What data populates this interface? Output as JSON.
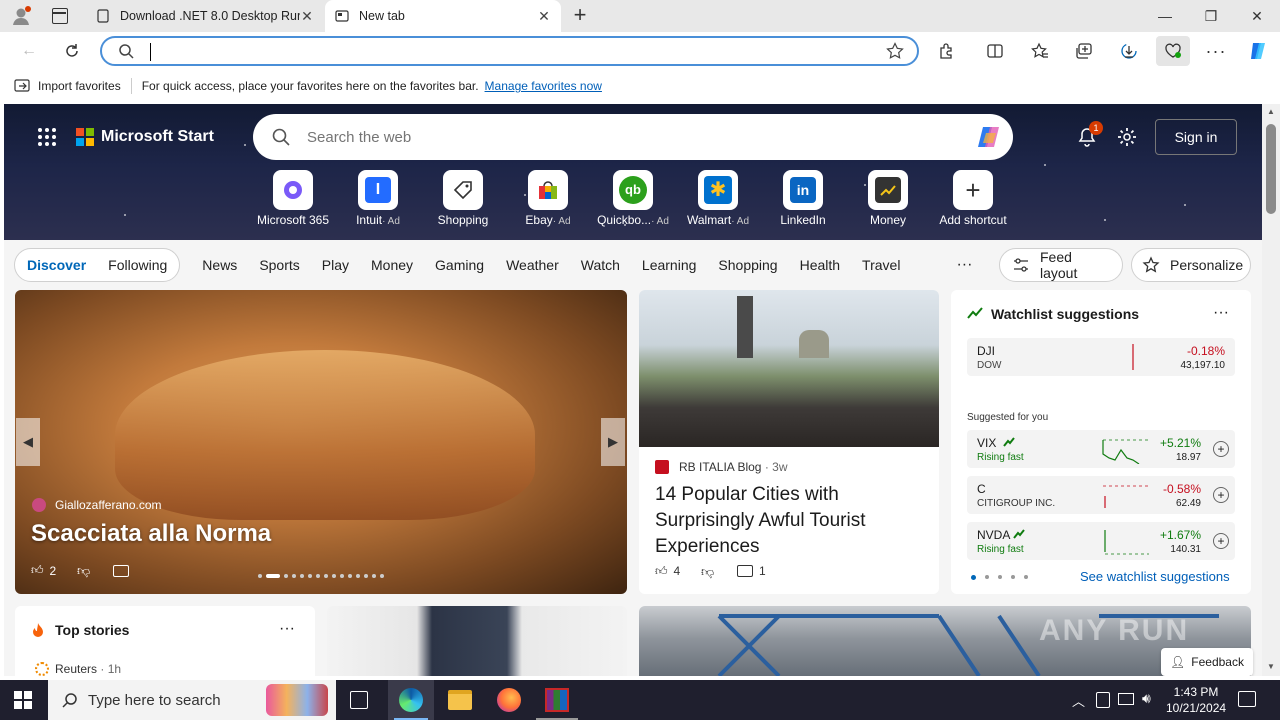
{
  "tabs": [
    {
      "title": "Download .NET 8.0 Desktop Runt",
      "close": "✕"
    },
    {
      "title": "New tab",
      "close": "✕"
    }
  ],
  "new_tab_symbol": "+",
  "window_controls": {
    "minimize": "—",
    "maximize": "❐",
    "close": "✕"
  },
  "address": {
    "value": "",
    "placeholder": ""
  },
  "favorites_bar": {
    "import_label": "Import favorites",
    "message": "For quick access, place your favorites here on the favorites bar.",
    "manage_link": "Manage favorites now"
  },
  "msn": {
    "brand": "Microsoft Start",
    "search_placeholder": "Search the web",
    "notification_count": "1",
    "sign_in": "Sign in",
    "shortcuts": [
      {
        "label": "Microsoft 365",
        "icon": "microsoft-365-icon",
        "ad": ""
      },
      {
        "label": "Intuit",
        "icon": "intuit-icon",
        "ad": "· Ad"
      },
      {
        "label": "Shopping",
        "icon": "shopping-tag-icon",
        "ad": ""
      },
      {
        "label": "Ebay",
        "icon": "ebay-bag-icon",
        "ad": "· Ad"
      },
      {
        "label": "Quickbo...",
        "icon": "quickbooks-icon",
        "ad": "· Ad"
      },
      {
        "label": "Walmart",
        "icon": "walmart-icon",
        "ad": "· Ad"
      },
      {
        "label": "LinkedIn",
        "icon": "linkedin-icon",
        "ad": ""
      },
      {
        "label": "Money",
        "icon": "money-chart-icon",
        "ad": ""
      },
      {
        "label": "Add shortcut",
        "icon": "plus-icon",
        "ad": ""
      }
    ],
    "feed_tabs": {
      "active": "Discover",
      "second": "Following"
    },
    "nav_items": [
      "News",
      "Sports",
      "Play",
      "Money",
      "Gaming",
      "Weather",
      "Watch",
      "Learning",
      "Shopping",
      "Health",
      "Travel"
    ],
    "more": "···",
    "feed_layout": "Feed layout",
    "personalize": "Personalize"
  },
  "hero_article": {
    "source": "Giallozafferano.com",
    "title": "Scacciata alla Norma",
    "likes": "2"
  },
  "article2": {
    "source": "RB ITALIA Blog",
    "age": "· 3w",
    "title": "14 Popular Cities with Surprisingly Awful Tourist Experiences",
    "likes": "4",
    "comments": "1"
  },
  "watchlist": {
    "title": "Watchlist suggestions",
    "more": "···",
    "suggested_label": "Suggested for you",
    "link": "See watchlist suggestions",
    "items": [
      {
        "symbol": "DJI",
        "name": "DOW",
        "change": "-0.18%",
        "price": "43,197.10",
        "direction": "down",
        "rising": false
      },
      {
        "symbol": "VIX",
        "name": "Rising fast",
        "change": "+5.21%",
        "price": "18.97",
        "direction": "up",
        "rising": true
      },
      {
        "symbol": "C",
        "name": "CITIGROUP INC.",
        "change": "-0.58%",
        "price": "62.49",
        "direction": "down",
        "rising": false
      },
      {
        "symbol": "NVDA",
        "name": "Rising fast",
        "change": "+1.67%",
        "price": "140.31",
        "direction": "up",
        "rising": true
      }
    ]
  },
  "top_stories": {
    "title": "Top stories",
    "more": "···",
    "source": "Reuters",
    "age": "· 1h"
  },
  "feedback": "Feedback",
  "watermark": "ANY RUN",
  "taskbar": {
    "search_placeholder": "Type here to search",
    "time": "1:43 PM",
    "date": "10/21/2024"
  },
  "colors": {
    "accent": "#0067b8",
    "link": "#005fb8",
    "red": "#c50f1f",
    "green": "#107c10"
  }
}
